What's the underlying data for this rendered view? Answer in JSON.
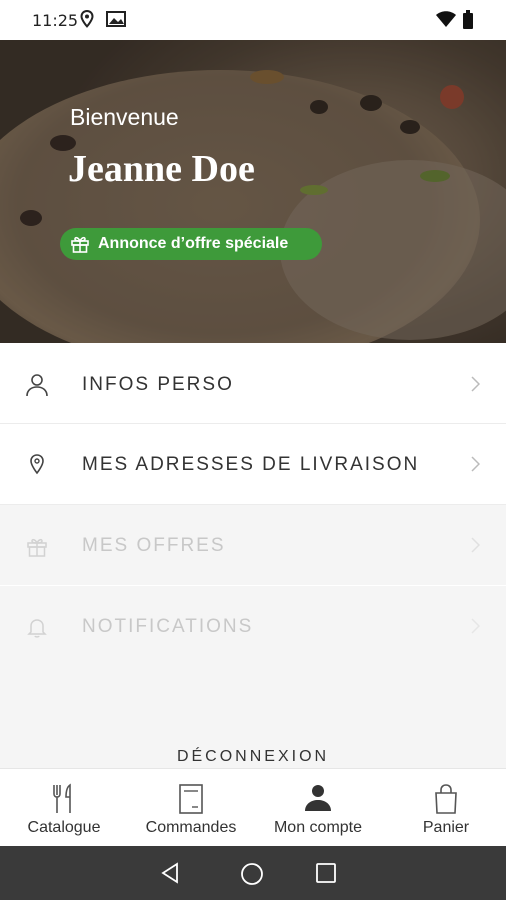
{
  "status_bar": {
    "time": "11:25"
  },
  "hero": {
    "greeting": "Bienvenue",
    "name": "Jeanne Doe",
    "offer_badge": "Annonce d’offre spéciale"
  },
  "menu": [
    {
      "label": "INFOS PERSO",
      "icon": "user-icon",
      "enabled": true
    },
    {
      "label": "MES ADRESSES DE LIVRAISON",
      "icon": "location-pin-icon",
      "enabled": true
    },
    {
      "label": "MES OFFRES",
      "icon": "gift-icon",
      "enabled": false
    },
    {
      "label": "NOTIFICATIONS",
      "icon": "bell-icon",
      "enabled": false
    }
  ],
  "logout_label": "DÉCONNEXION",
  "bottom_nav": [
    {
      "label": "Catalogue",
      "icon": "fork-knife-icon"
    },
    {
      "label": "Commandes",
      "icon": "receipt-icon"
    },
    {
      "label": "Mon compte",
      "icon": "account-icon",
      "active": true
    },
    {
      "label": "Panier",
      "icon": "shopping-bag-icon"
    }
  ],
  "colors": {
    "accent_green": "#3e9a3a",
    "system_nav": "#3a3a3a",
    "disabled_text": "#c8c8c8"
  }
}
